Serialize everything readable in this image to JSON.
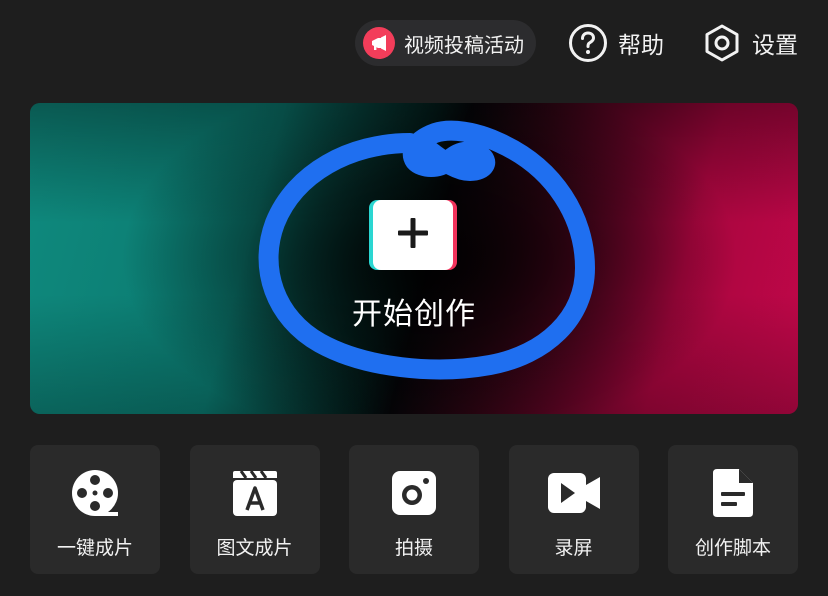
{
  "colors": {
    "background": "#1e1e1e",
    "tile_background": "#2a2a2a",
    "promo_accent": "#f33d5a",
    "scribble": "#1f6ff0",
    "brand_cyan": "#2ad6d1",
    "brand_red": "#f2335c"
  },
  "header": {
    "promo": {
      "icon": "megaphone-icon",
      "label": "视频投稿活动"
    },
    "help": {
      "icon": "help-circle-icon",
      "label": "帮助"
    },
    "settings": {
      "icon": "hexagon-gear-icon",
      "label": "设置"
    }
  },
  "banner": {
    "create_icon": "plus-icon",
    "create_label": "开始创作"
  },
  "tools": [
    {
      "icon": "film-reel-icon",
      "label": "一键成片"
    },
    {
      "icon": "clapboard-text-icon",
      "label": "图文成片"
    },
    {
      "icon": "camera-icon",
      "label": "拍摄"
    },
    {
      "icon": "video-camera-icon",
      "label": "录屏"
    },
    {
      "icon": "document-icon",
      "label": "创作脚本"
    }
  ]
}
